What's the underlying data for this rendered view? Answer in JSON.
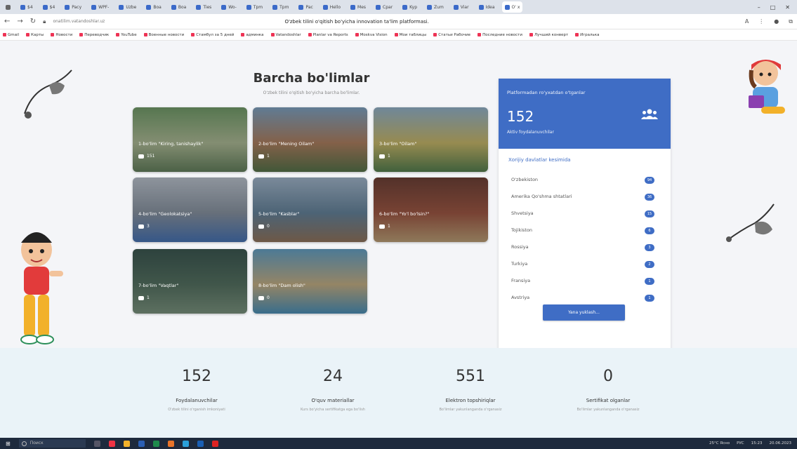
{
  "browser": {
    "tabs": [
      {
        "label": "$4"
      },
      {
        "label": "$4"
      },
      {
        "label": "Pacy"
      },
      {
        "label": "WPF-"
      },
      {
        "label": "Uzbe"
      },
      {
        "label": "Boa"
      },
      {
        "label": "Boa"
      },
      {
        "label": "Ties"
      },
      {
        "label": "Wo-"
      },
      {
        "label": "Tpm"
      },
      {
        "label": "Tpm"
      },
      {
        "label": "Pac"
      },
      {
        "label": "Hello"
      },
      {
        "label": "Mes"
      },
      {
        "label": "Cpar"
      },
      {
        "label": "Kyp"
      },
      {
        "label": "Zum"
      },
      {
        "label": "Viar"
      },
      {
        "label": "Idea"
      },
      {
        "label": "O' x",
        "active": true
      }
    ],
    "url": "onatilim.vatandoshlar.uz",
    "page_title": "O'zbek tilini o'qitish bo'yicha innovation ta'lim platformasi.",
    "bookmarks": [
      "Gmail",
      "Карты",
      "Новости",
      "Переводчик",
      "YouTube",
      "Военные новости",
      "Стамбул за 5 дней",
      "админка",
      "Vatandoshlar",
      "Planlar va Reports",
      "Moskva Vision",
      "Мои таблицы",
      "Статьи Рабочие",
      "Последние новости",
      "Лучший конверт",
      "Игралька"
    ]
  },
  "main": {
    "title": "Barcha bo'limlar",
    "subtitle": "O'zbek tilini o'qitish bo'yicha barcha bo'limlar."
  },
  "sections": [
    {
      "title": "1-bo'lim \"Kiring, tanishaylik\"",
      "count": "151",
      "palette": [
        "#7fae6a",
        "#c8d3a0",
        "#6d8b5a"
      ]
    },
    {
      "title": "2-bo'lim \"Mening Oilam\"",
      "count": "1",
      "palette": [
        "#8fb6d6",
        "#c88b5e",
        "#5d7b43"
      ]
    },
    {
      "title": "3-bo'lim \"Oilam\"",
      "count": "1",
      "palette": [
        "#a7c9e0",
        "#e7cf6a",
        "#5c8a4a"
      ]
    },
    {
      "title": "4-bo'lim \"Geolokatsiya\"",
      "count": "3",
      "palette": [
        "#d8dde4",
        "#9aa3ad",
        "#4a7bc3"
      ]
    },
    {
      "title": "5-bo'lim \"Kasblar\"",
      "count": "0",
      "palette": [
        "#b9cde0",
        "#6f8fa6",
        "#a47d5a"
      ]
    },
    {
      "title": "6-bo'lim \"Yo'l bo'lsin?\"",
      "count": "1",
      "palette": [
        "#7a3f2c",
        "#b55a3c",
        "#d9b27a"
      ]
    },
    {
      "title": "7-bo'lim \"Vaqtlar\"",
      "count": "1",
      "palette": [
        "#3d5a4c",
        "#5c7a60",
        "#8aa384"
      ]
    },
    {
      "title": "8-bo'lim \"Dam olish\"",
      "count": "0",
      "palette": [
        "#6fb3d9",
        "#e3c58c",
        "#4f9fc9"
      ]
    }
  ],
  "panel": {
    "top_title": "Platformadan ro'yxatdan o'tganlar",
    "count": "152",
    "count_label": "Aktiv foydalanuvchilar",
    "icon": "users-icon",
    "countries_title": "Xorijiy davlatlar kesimida",
    "countries": [
      {
        "name": "O'zbekiston",
        "value": "94"
      },
      {
        "name": "Amerika Qo'shma shtatlari",
        "value": "36"
      },
      {
        "name": "Shvetsiya",
        "value": "15"
      },
      {
        "name": "Tojikiston",
        "value": "6"
      },
      {
        "name": "Rossiya",
        "value": "3"
      },
      {
        "name": "Turkiya",
        "value": "2"
      },
      {
        "name": "Fransiya",
        "value": "1"
      },
      {
        "name": "Avstriya",
        "value": "1"
      }
    ],
    "load_more": "Yana yuklash..."
  },
  "stats": [
    {
      "number": "152",
      "label": "Foydalanuvchilar",
      "desc": "O'zbek tilini o'rganish imkoniyati"
    },
    {
      "number": "24",
      "label": "O'quv materiallar",
      "desc": "Kurs bo'yicha sertifikatga ega bo'lish"
    },
    {
      "number": "551",
      "label": "Elektron topshiriqlar",
      "desc": "Bo'limlar yakunlanganda o'rganasiz"
    },
    {
      "number": "0",
      "label": "Sertifikat olganlar",
      "desc": "Bo'limlar yakunlanganda o'rganasiz"
    }
  ],
  "taskbar": {
    "search_placeholder": "Поиск",
    "weather": "25°C Ясно",
    "lang": "РУС",
    "time": "15:23",
    "date": "20.06.2023"
  },
  "colors": {
    "accent": "#3f6dc5",
    "page_bg": "#f4f5f8",
    "stats_bg": "#eaf3f8"
  }
}
